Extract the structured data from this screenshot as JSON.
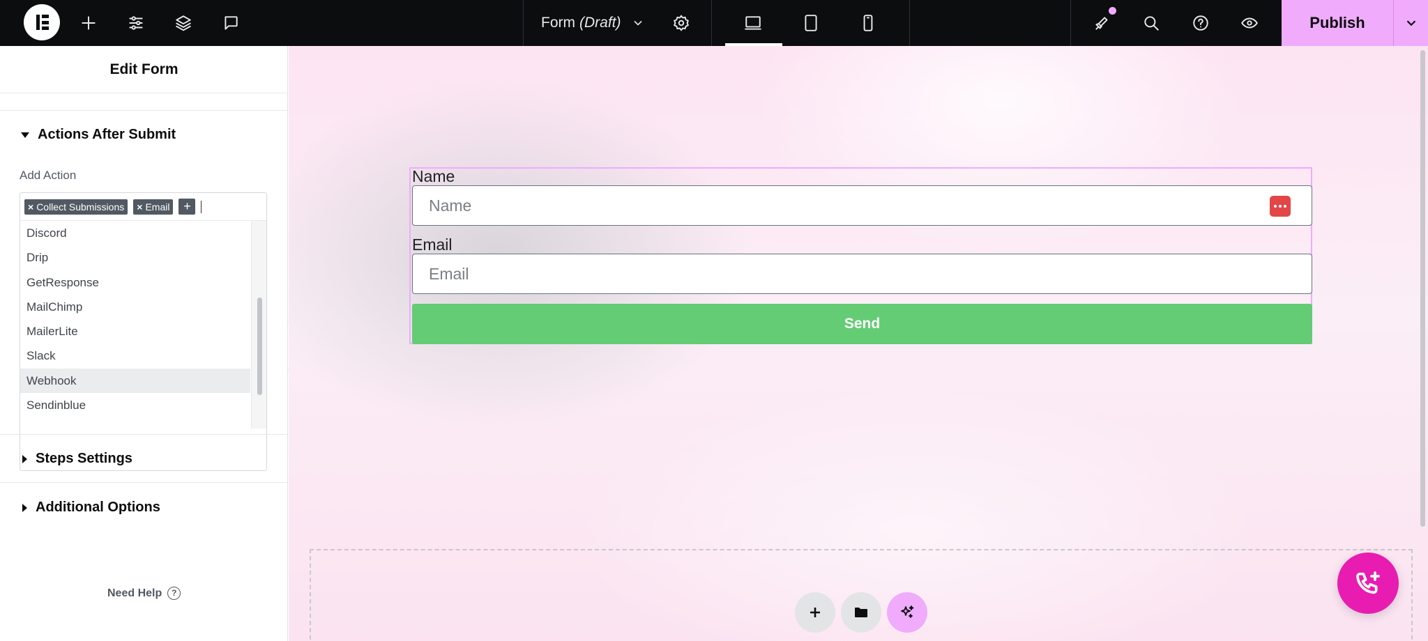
{
  "topbar": {
    "document_name": "Form",
    "document_status": "(Draft)",
    "publish_label": "Publish",
    "icons": [
      "elementor-logo",
      "add-element-icon",
      "site-settings-icon",
      "structure-layers-icon",
      "comments-icon",
      "page-settings-icon",
      "desktop-icon",
      "tablet-icon",
      "mobile-icon",
      "whats-new-icon",
      "finder-search-icon",
      "help-icon",
      "preview-eye-icon",
      "chevron-down-icon"
    ],
    "active_device": "desktop"
  },
  "panel": {
    "title": "Edit Form",
    "sections": {
      "actions_after_submit": "Actions After Submit",
      "steps_settings": "Steps Settings",
      "additional_options": "Additional Options"
    },
    "add_action_label": "Add Action",
    "selected_tags": [
      "Collect Submissions",
      "Email"
    ],
    "tag_remove_glyph": "×",
    "add_tag_glyph": "+",
    "dropdown_options": [
      "Discord",
      "Drip",
      "GetResponse",
      "MailChimp",
      "MailerLite",
      "Slack",
      "Webhook",
      "Sendinblue"
    ],
    "highlighted_option": "Webhook",
    "need_help": "Need Help",
    "help_glyph": "?"
  },
  "form": {
    "name_label": "Name",
    "name_placeholder": "Name",
    "email_label": "Email",
    "email_placeholder": "Email",
    "submit_label": "Send"
  },
  "colors": {
    "topbar_bg": "#0c0d0e",
    "publish_bg": "#f0abfc",
    "send_button": "#64cc75",
    "form_outline": "#f0abfc",
    "fab": "#e81cb0",
    "password_manager_icon": "#e34646"
  }
}
